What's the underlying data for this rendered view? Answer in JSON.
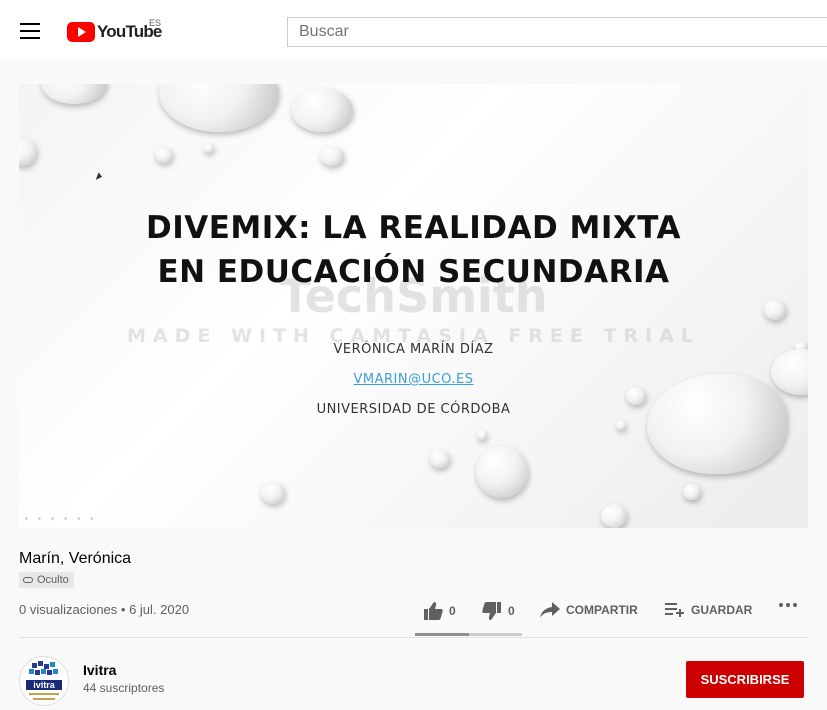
{
  "header": {
    "logo_text": "YouTube",
    "region": "ES",
    "search_placeholder": "Buscar"
  },
  "video": {
    "slide": {
      "title_line1": "DIVEMIX: LA REALIDAD MIXTA",
      "title_line2": "EN EDUCACIÓN SECUNDARIA",
      "author": "VERÓNICA MARÍN DÍAZ",
      "email": "VMARIN@UCO.ES",
      "institution": "UNIVERSIDAD DE CÓRDOBA",
      "watermark_brand": "TechSmith",
      "watermark_text": "MADE WITH CAMTASIA FREE TRIAL"
    },
    "title": "Marín, Verónica",
    "visibility": "Oculto",
    "views": "0 visualizaciones",
    "date": "6 jul. 2020",
    "meta_separator": " • "
  },
  "actions": {
    "likes": "0",
    "dislikes": "0",
    "share_label": "COMPARTIR",
    "save_label": "GUARDAR",
    "like_ratio": 0.5
  },
  "channel": {
    "name": "Ivitra",
    "subscribers": "44 suscriptores",
    "subscribe_label": "SUSCRIBIRSE",
    "avatar_text": "ivitra"
  },
  "colors": {
    "brand_red": "#ff0000",
    "subscribe_red": "#cc0000",
    "link_blue": "#3a9fd6"
  }
}
